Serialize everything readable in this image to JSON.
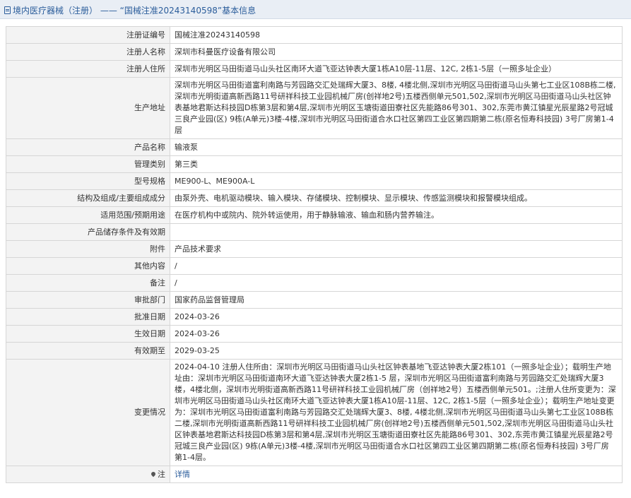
{
  "breadcrumb": {
    "section": "境内医疗器械（注册）",
    "separator": " —— ",
    "record": "“国械注准20243140598”基本信息"
  },
  "rows": [
    {
      "label": "注册证编号",
      "value": "国械注准20243140598"
    },
    {
      "label": "注册人名称",
      "value": "深圳市科曼医疗设备有限公司"
    },
    {
      "label": "注册人住所",
      "value": "深圳市光明区马田街道马山头社区南环大道飞亚达钟表大厦1栋A10层-11层、12C, 2栋1-5层（一照多址企业）"
    },
    {
      "label": "生产地址",
      "value": "深圳市光明区马田街道富利南路与芳园路交汇处瑞辉大厦3、8楼, 4楼北侧,深圳市光明区马田街道马山头第七工业区108B栋二楼,深圳市光明街道高新西路11号研祥科技工业园机械厂房(创祥地2号)五楼西侧单元501,502,深圳市光明区马田街道马山头社区钟表基地君斯达科技园D栋第3层和第4层,深圳市光明区玉塘街道田寮社区先能路86号301、302,东莞市黄江镇星光辰星路2号冠城三良产业园(区) 9栋(A单元)3楼-4楼,深圳市光明区马田街道合水口社区第四工业区第四期第二栋(原名恒寿科技园) 3号厂房第1-4层"
    },
    {
      "label": "产品名称",
      "value": "输液泵"
    },
    {
      "label": "管理类别",
      "value": "第三类"
    },
    {
      "label": "型号规格",
      "value": "ME900-L、ME900A-L"
    },
    {
      "label": "结构及组成/主要组成成分",
      "value": "由泵外壳、电机驱动模块、输入模块、存储模块、控制模块、显示模块、传感监测模块和报警模块组成。"
    },
    {
      "label": "适用范围/预期用途",
      "value": "在医疗机构中或院内、院外转运使用，用于静脉输液、输血和肠内营养输注。"
    },
    {
      "label": "产品储存条件及有效期",
      "value": ""
    },
    {
      "label": "附件",
      "value": "产品技术要求"
    },
    {
      "label": "其他内容",
      "value": "/"
    },
    {
      "label": "备注",
      "value": "/"
    },
    {
      "label": "审批部门",
      "value": "国家药品监督管理局"
    },
    {
      "label": "批准日期",
      "value": "2024-03-26"
    },
    {
      "label": "生效日期",
      "value": "2024-03-26"
    },
    {
      "label": "有效期至",
      "value": "2029-03-25"
    },
    {
      "label": "变更情况",
      "value": "2024-04-10 注册人住所由：深圳市光明区马田街道马山头社区钟表基地飞亚达钟表大厦2栋101（一照多址企业）；载明生产地址由：深圳市光明区马田街道南环大道飞亚达钟表大厦2栋1-5 层，深圳市光明区马田街道富利南路与芳园路交汇处瑞辉大厦3楼，4楼北侧，深圳市光明街道高新西路11号研祥科技工业园机械厂房（创祥地2号）五楼西侧单元501。;注册人住所变更为：深圳市光明区马田街道马山头社区南环大道飞亚达钟表大厦1栋A10层-11层、12C, 2栋1-5层（一照多址企业）；载明生产地址变更为：深圳市光明区马田街道富利南路与芳园路交汇处瑞辉大厦3、8楼, 4楼北侧,深圳市光明区马田街道马山头第七工业区108B栋二楼,深圳市光明街道高新西路11号研祥科技工业园机械厂房(创祥地2号)五楼西侧单元501,502,深圳市光明区马田街道马山头社区钟表基地君斯达科技园D栋第3层和第4层,深圳市光明区玉塘街道田寮社区先能路86号301、302,东莞市黄江镇星光辰星路2号冠城三良产业园(区) 9栋(A单元)3楼-4楼,深圳市光明区马田街道合水口社区第四工业区第四期第二栋(原名恒寿科技园) 3号厂房第1-4层。"
    }
  ],
  "note": {
    "label": "注",
    "link": "详情"
  },
  "colors": {
    "link": "#2b5d9b",
    "label_bg": "#f3f3f3",
    "border": "#d6d6d6",
    "topbar_bg": "#e9eef5"
  },
  "icons": {
    "breadcrumb": "document-icon",
    "note": "pin-icon"
  }
}
